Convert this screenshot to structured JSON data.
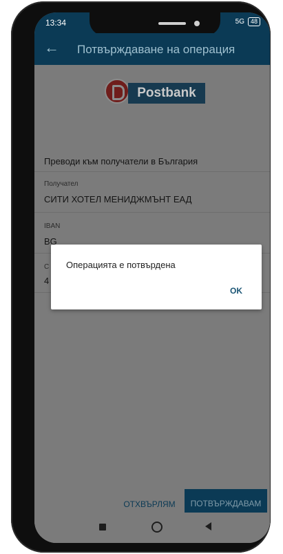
{
  "status": {
    "time": "13:34",
    "signal": "5G",
    "battery": "48"
  },
  "appbar": {
    "back_icon": "arrow-left-icon",
    "title": "Потвърждаване на операция"
  },
  "logo": {
    "text": "Postbank"
  },
  "details": {
    "transfer_type": "Преводи към получатели в България",
    "recipient_label": "Получател",
    "recipient_value": "СИТИ ХОТЕЛ МЕНИДЖМЪНТ ЕАД",
    "iban_label": "IBAN",
    "iban_value": "BG",
    "partial_label": "С",
    "partial_value": "4"
  },
  "dialog": {
    "message": "Операцията е потвърдена",
    "ok_label": "OK"
  },
  "actions": {
    "reject_label": "ОТХВЪРЛЯМ",
    "confirm_label": "ПОТВЪРЖДАВАМ"
  },
  "colors": {
    "brand": "#0b3a55",
    "accent_text": "#1a5575",
    "overlay": "#7b7b7b"
  }
}
